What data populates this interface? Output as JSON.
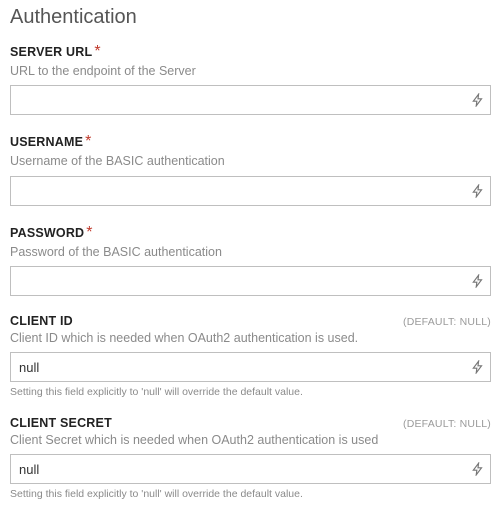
{
  "section": {
    "title": "Authentication"
  },
  "fields": {
    "server_url": {
      "label": "SERVER URL",
      "required_mark": "*",
      "desc": "URL to the endpoint of the Server",
      "value": ""
    },
    "username": {
      "label": "USERNAME",
      "required_mark": "*",
      "desc": "Username of the BASIC authentication",
      "value": ""
    },
    "password": {
      "label": "PASSWORD",
      "required_mark": "*",
      "desc": "Password of the BASIC authentication",
      "value": ""
    },
    "client_id": {
      "label": "CLIENT ID",
      "default_tag": "(DEFAULT: NULL)",
      "desc": "Client ID which is needed when OAuth2 authentication is used.",
      "value": "null",
      "hint": "Setting this field explicitly to 'null' will override the default value."
    },
    "client_secret": {
      "label": "CLIENT SECRET",
      "default_tag": "(DEFAULT: NULL)",
      "desc": "Client Secret which is needed when OAuth2 authentication is used",
      "value": "null",
      "hint": "Setting this field explicitly to 'null' will override the default value."
    }
  }
}
